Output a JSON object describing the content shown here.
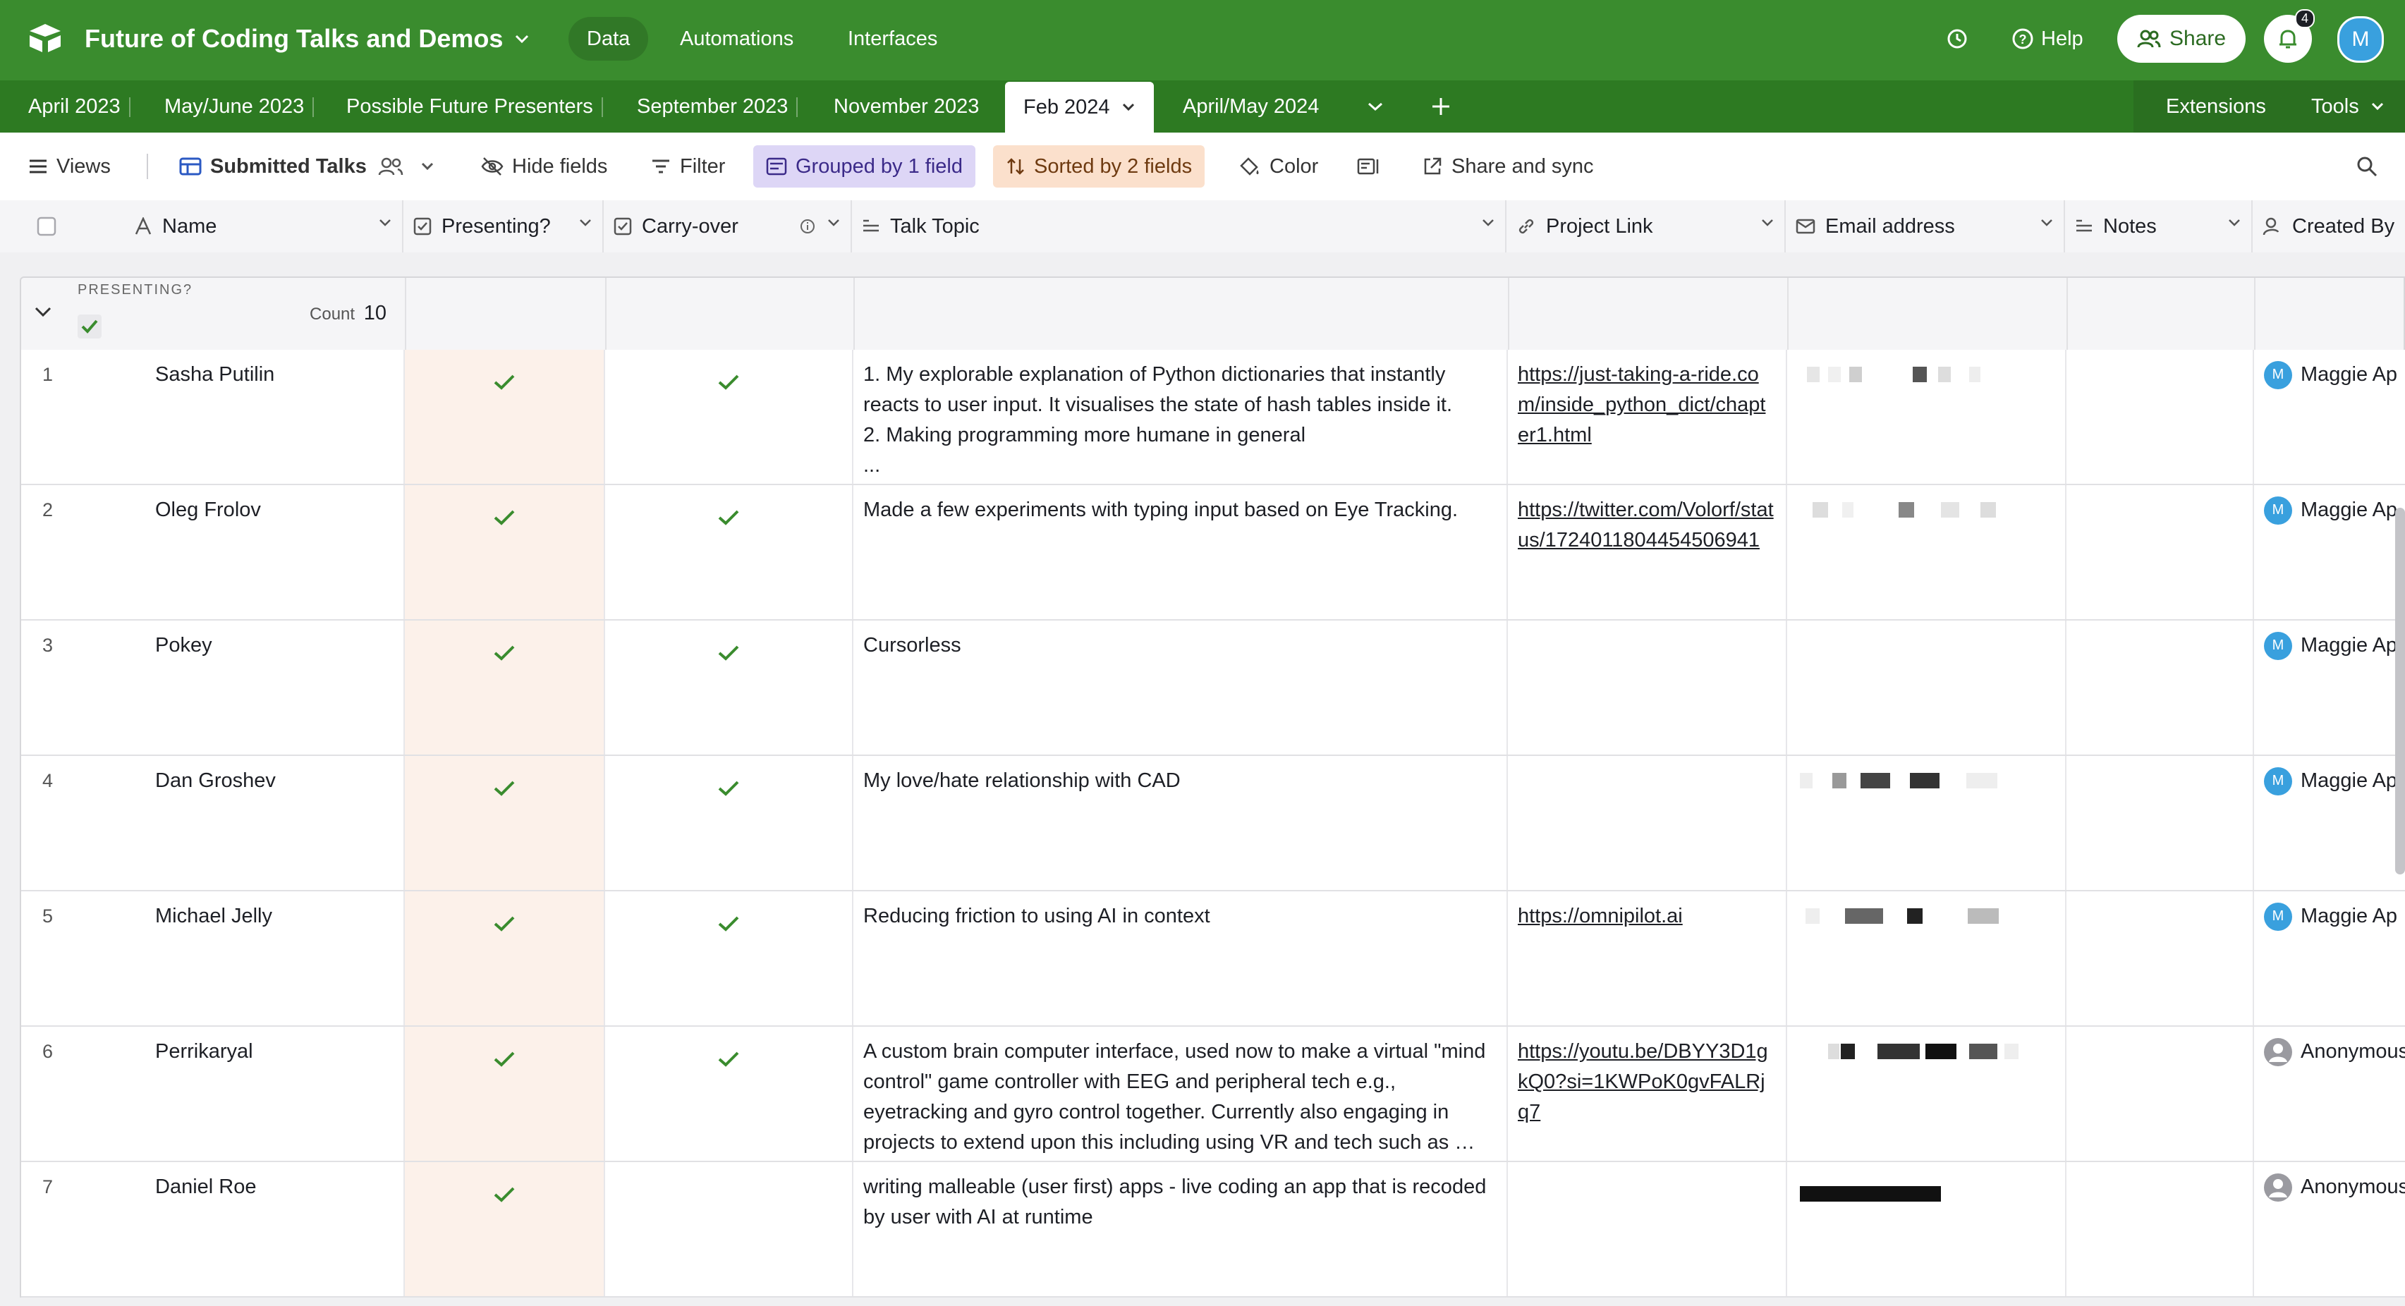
{
  "app": {
    "base_title": "Future of Coding Talks and Demos",
    "nav": [
      "Data",
      "Automations",
      "Interfaces"
    ],
    "help_label": "Help",
    "share_label": "Share",
    "notification_count": "4",
    "user_initial": "M",
    "brand_color": "#3a8c2e"
  },
  "tabs": [
    {
      "label": "April 2023"
    },
    {
      "label": "May/June 2023"
    },
    {
      "label": "Possible Future Presenters"
    },
    {
      "label": "September 2023"
    },
    {
      "label": "November 2023"
    },
    {
      "label": "Feb 2024",
      "active": true
    },
    {
      "label": "April/May 2024"
    }
  ],
  "tabbar_right": {
    "extensions": "Extensions",
    "tools": "Tools"
  },
  "viewbar": {
    "views": "Views",
    "view_name": "Submitted Talks",
    "hide_fields": "Hide fields",
    "filter": "Filter",
    "grouped": "Grouped by 1 field",
    "sorted": "Sorted by 2 fields",
    "color": "Color",
    "share_sync": "Share and sync"
  },
  "columns": [
    "Name",
    "Presenting?",
    "Carry-over",
    "Talk Topic",
    "Project Link",
    "Email address",
    "Notes",
    "Created By"
  ],
  "group": {
    "label": "PRESENTING?",
    "count_label": "Count",
    "count": "10"
  },
  "rows": [
    {
      "num": "1",
      "name": "Sasha Putilin",
      "presenting": true,
      "carry": true,
      "topic": "1. My explorable explanation of Python dictionaries that instantly reacts to user input. It visualises the state of hash tables inside it.\n2. Making programming more humane in general\n...",
      "link": "https://just-taking-a-ride.com/inside_python_dict/chapter1.html",
      "created": "Maggie Ap",
      "creator_type": "user"
    },
    {
      "num": "2",
      "name": "Oleg Frolov",
      "presenting": true,
      "carry": true,
      "topic": "Made a few experiments with typing input based on Eye Tracking.",
      "link": "https://twitter.com/Volorf/status/1724011804454506941",
      "created": "Maggie Ap",
      "creator_type": "user"
    },
    {
      "num": "3",
      "name": "Pokey",
      "presenting": true,
      "carry": true,
      "topic": "Cursorless",
      "link": "",
      "created": "Maggie Ap",
      "creator_type": "user"
    },
    {
      "num": "4",
      "name": "Dan Groshev",
      "presenting": true,
      "carry": true,
      "topic": "My love/hate relationship with CAD",
      "link": "",
      "created": "Maggie Ap",
      "creator_type": "user"
    },
    {
      "num": "5",
      "name": "Michael Jelly",
      "presenting": true,
      "carry": true,
      "topic": "Reducing friction to using AI in context",
      "link": "https://omnipilot.ai",
      "created": "Maggie Ap",
      "creator_type": "user"
    },
    {
      "num": "6",
      "name": "Perrikaryal",
      "presenting": true,
      "carry": true,
      "topic": "A custom brain computer interface, used now to make a virtual \"mind control\" game controller with EEG and peripheral tech e.g., eyetracking and gyro control together. Currently also engaging in projects to extend upon this including using VR and tech such as …",
      "link": "https://youtu.be/DBYY3D1gkQ0?si=1KWPoK0gvFALRjq7",
      "created": "Anonymous",
      "creator_type": "anon"
    },
    {
      "num": "7",
      "name": "Daniel Roe",
      "presenting": true,
      "carry": false,
      "topic": "writing malleable (user first) apps - live coding an app that is recoded by user with AI at runtime",
      "link": "",
      "created": "Anonymous",
      "creator_type": "anon"
    }
  ]
}
